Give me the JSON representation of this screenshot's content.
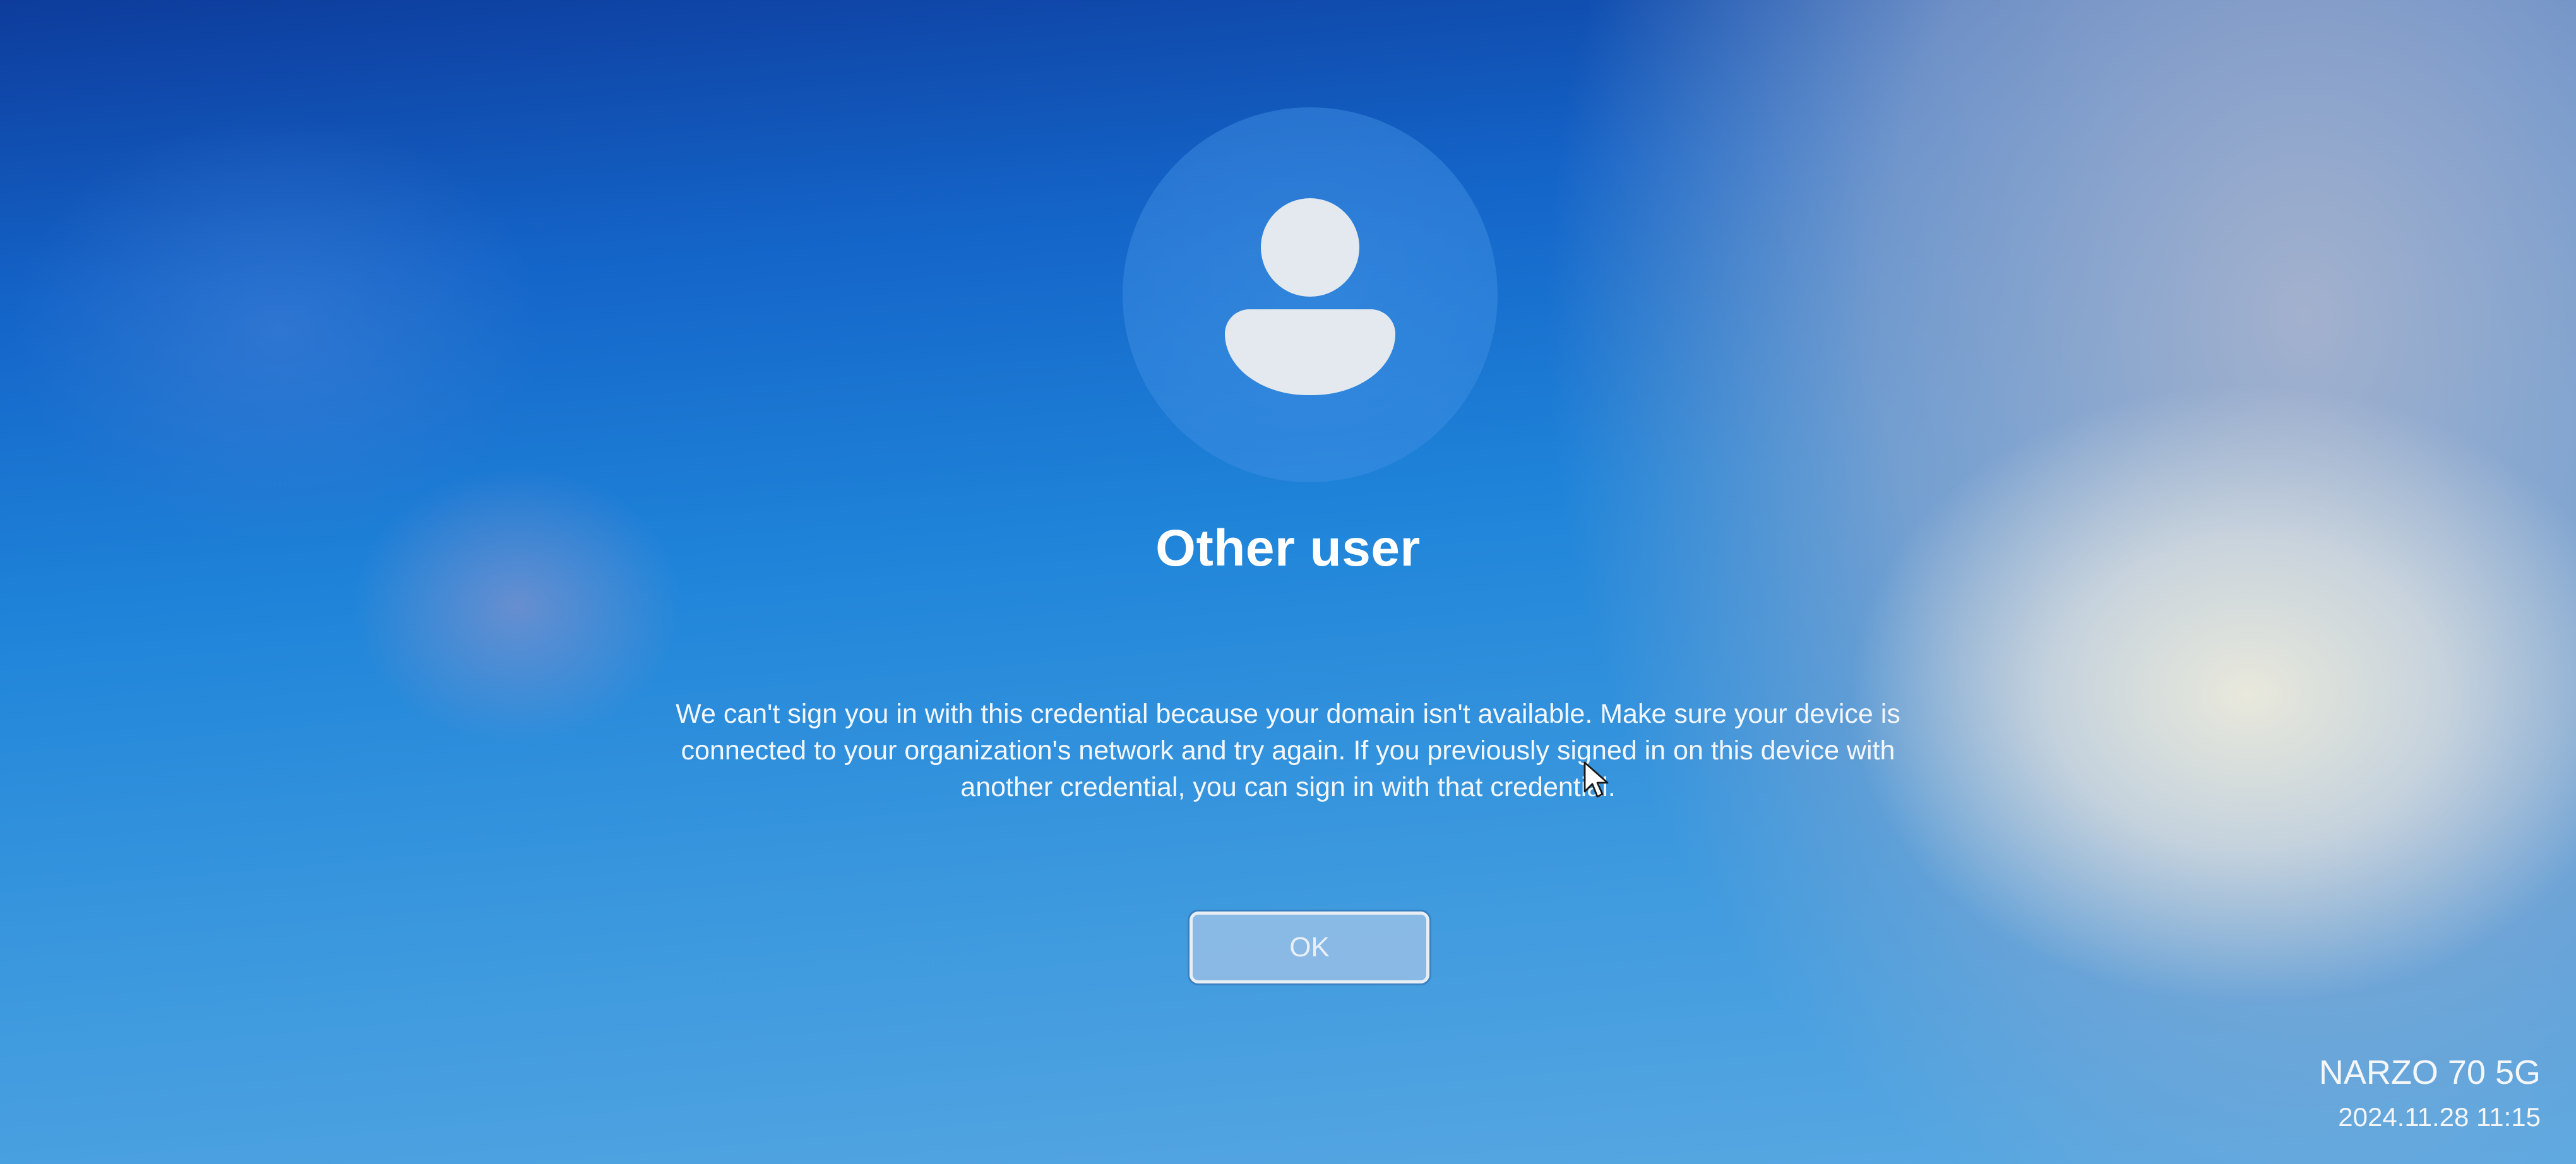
{
  "login": {
    "avatar_icon": "user-silhouette-icon",
    "title": "Other user",
    "message": "We can't sign you in with this credential because your domain isn't available. Make sure your device is connected to your organization's network and try again. If you previously signed in on this device with another credential, you can sign in with that credential.",
    "ok_label": "OK"
  },
  "cursor": {
    "icon": "mouse-pointer-icon"
  },
  "camera_watermark": {
    "model": "NARZO 70 5G",
    "datetime": "2024.11.28 11:15"
  }
}
